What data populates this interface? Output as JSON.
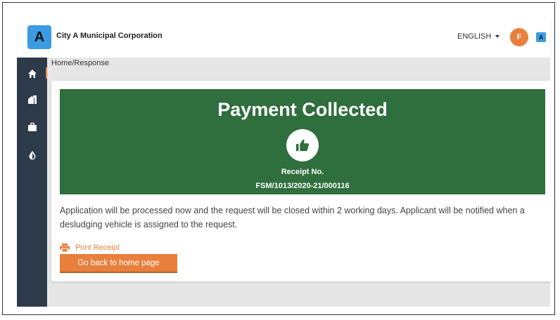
{
  "header": {
    "logo_letter": "A",
    "org_name": "City A Municipal Corporation",
    "language": "ENGLISH",
    "avatar_initial": "F",
    "badge_letter": "A"
  },
  "sidebar": {
    "items": [
      {
        "icon": "home-icon"
      },
      {
        "icon": "building-icon"
      },
      {
        "icon": "briefcase-icon"
      },
      {
        "icon": "drop-icon"
      }
    ]
  },
  "breadcrumb": "Home/Response",
  "banner": {
    "title": "Payment Collected",
    "icon": "thumbs-up-icon",
    "receipt_label": "Receipt No.",
    "receipt_number": "FSM/1013/2020-21/000116"
  },
  "message": "Application will be processed now and the request will be closed within 2 working days. Applicant will be notified when a desludging vehicle is assigned to the request.",
  "actions": {
    "print_label": "Print Receipt",
    "home_label": "Go back to home page"
  },
  "colors": {
    "accent": "#e97f3c",
    "success": "#2f6e3d",
    "sidebar": "#2d3a4a",
    "brand": "#3b9be0"
  }
}
